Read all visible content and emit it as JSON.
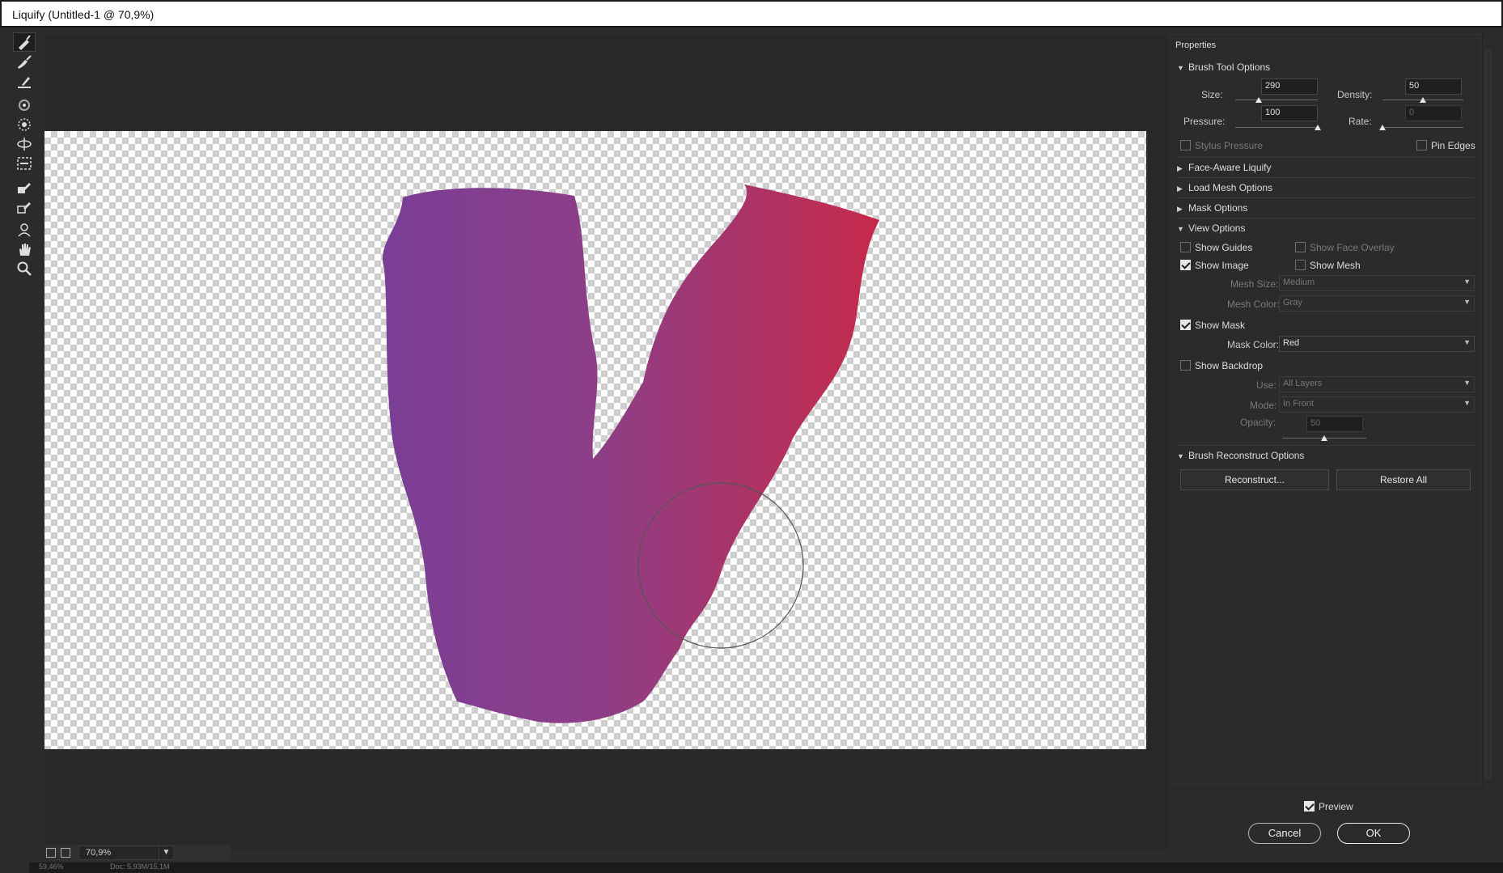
{
  "window": {
    "title": "Liquify (Untitled-1 @ 70,9%)"
  },
  "tools": [
    {
      "name": "forward-warp-tool-icon",
      "active": true
    },
    {
      "name": "reconstruct-tool-icon"
    },
    {
      "name": "smooth-tool-icon"
    },
    {
      "name": "twirl-clockwise-tool-icon"
    },
    {
      "name": "pucker-tool-icon"
    },
    {
      "name": "bloat-tool-icon"
    },
    {
      "name": "push-left-tool-icon"
    },
    {
      "name": "freeze-mask-tool-icon"
    },
    {
      "name": "thaw-mask-tool-icon"
    },
    {
      "name": "face-tool-icon"
    },
    {
      "name": "hand-tool-icon"
    },
    {
      "name": "zoom-tool-icon"
    }
  ],
  "canvas": {
    "shape_gradient": [
      "#7a3e96",
      "#8e3e86",
      "#c62a4a"
    ]
  },
  "status": {
    "zoom": "70,9%",
    "footer_left": "59,46%",
    "footer_doc": "Doc: 5,93M/15,1M"
  },
  "panel": {
    "title": "Properties",
    "brush_tool": {
      "heading": "Brush Tool Options",
      "size_label": "Size:",
      "size": "290",
      "size_fraction": 0.28,
      "density_label": "Density:",
      "density": "50",
      "density_fraction": 0.5,
      "pressure_label": "Pressure:",
      "pressure": "100",
      "pressure_fraction": 1.0,
      "rate_label": "Rate:",
      "rate": "0",
      "rate_fraction": 0.0,
      "stylus_pressure": "Stylus Pressure",
      "pin_edges": "Pin Edges"
    },
    "face_aware": "Face-Aware Liquify",
    "load_mesh": "Load Mesh Options",
    "mask_options": "Mask Options",
    "view_options": {
      "heading": "View Options",
      "show_guides": "Show Guides",
      "show_face_overlay": "Show Face Overlay",
      "show_image": "Show Image",
      "show_mesh": "Show Mesh",
      "mesh_size_label": "Mesh Size:",
      "mesh_size": "Medium",
      "mesh_color_label": "Mesh Color:",
      "mesh_color": "Gray",
      "show_mask": "Show Mask",
      "mask_color_label": "Mask Color:",
      "mask_color": "Red",
      "show_backdrop": "Show Backdrop",
      "use_label": "Use:",
      "use": "All Layers",
      "mode_label": "Mode:",
      "mode": "In Front",
      "opacity_label": "Opacity:",
      "opacity": "50",
      "opacity_fraction": 0.5
    },
    "reconstruct": {
      "heading": "Brush Reconstruct Options",
      "reconstruct_btn": "Reconstruct...",
      "restore_btn": "Restore All"
    }
  },
  "footer": {
    "preview": "Preview",
    "cancel": "Cancel",
    "ok": "OK"
  }
}
